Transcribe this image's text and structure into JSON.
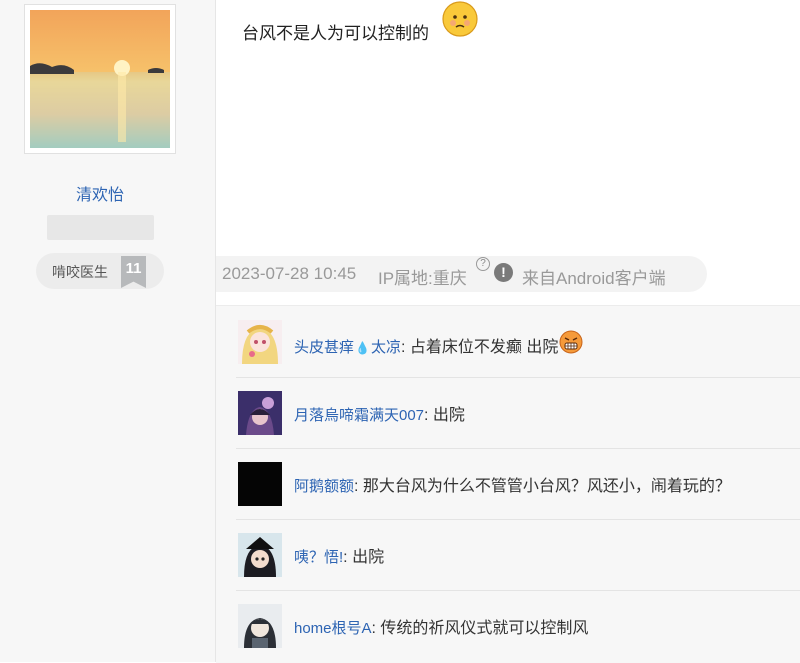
{
  "author": {
    "name": "清欢怡",
    "level_name": "啃咬医生",
    "level_number": "11"
  },
  "post": {
    "text": "台风不是人为可以控制的",
    "date": "2023-07-28 10:45",
    "ip_location": "IP属地:重庆",
    "help_icon_glyph": "?",
    "client": "来自Android客户端"
  },
  "comments": [
    {
      "user": "头皮甚痒",
      "user_suffix": "太凉",
      "text": "占着床位不发癫 出院"
    },
    {
      "user": "月落烏啼霜满天007",
      "text": "出院"
    },
    {
      "user": "阿鹅额额",
      "text": "那大台风为什么不管管小台风？风还小，闹着玩的？"
    },
    {
      "user": "咦？悟!",
      "text": "出院"
    },
    {
      "user": "home根号A",
      "text": "传统的祈风仪式就可以控制风"
    }
  ],
  "colors": {
    "link": "#2d64b3",
    "meta_text": "#999999",
    "sidebar_bg": "#f7f7f7"
  },
  "icons": {
    "post_emoji": "face-emoji-icon",
    "help": "help-circle-icon",
    "alert": "alert-circle-icon",
    "drop": "water-drop-icon",
    "comment_emoji": "grin-emoji-icon"
  }
}
